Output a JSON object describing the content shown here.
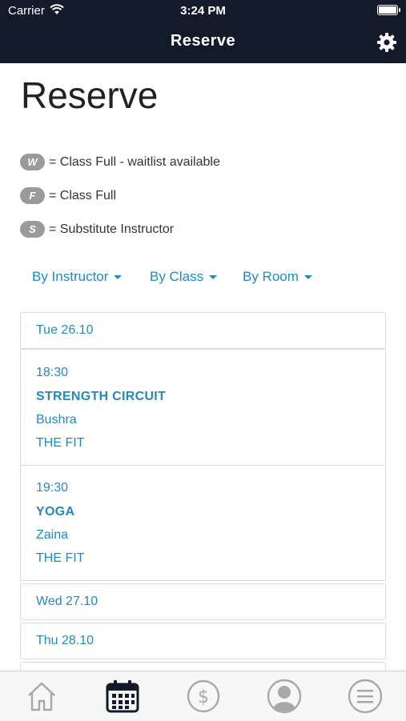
{
  "status_bar": {
    "carrier": "Carrier",
    "time": "3:24 PM"
  },
  "nav": {
    "title": "Reserve",
    "settings_icon": "gear-icon"
  },
  "page": {
    "title": "Reserve"
  },
  "legend": [
    {
      "badge": "W",
      "text": "= Class Full - waitlist available"
    },
    {
      "badge": "F",
      "text": "= Class Full"
    },
    {
      "badge": "S",
      "text": "= Substitute Instructor"
    }
  ],
  "filters": [
    "By Instructor",
    "By Class",
    "By Room"
  ],
  "days": [
    {
      "label": "Tue 26.10",
      "classes": [
        {
          "time": "18:30",
          "name": "STRENGTH CIRCUIT",
          "instructor": "Bushra",
          "room": "THE FIT"
        },
        {
          "time": "19:30",
          "name": "YOGA",
          "instructor": "Zaina",
          "room": "THE FIT"
        }
      ]
    },
    {
      "label": "Wed 27.10",
      "classes": []
    },
    {
      "label": "Thu 28.10",
      "classes": []
    }
  ],
  "tabbar": {
    "items": [
      "home-icon",
      "calendar-icon",
      "dollar-icon",
      "profile-icon",
      "menu-icon"
    ],
    "active": "calendar-icon",
    "active_color": "#131a29",
    "inactive_color": "#a8a8a8"
  },
  "colors": {
    "nav_bg": "#131a29",
    "link": "#1f8ac4",
    "badge": "#9a9a9a"
  }
}
